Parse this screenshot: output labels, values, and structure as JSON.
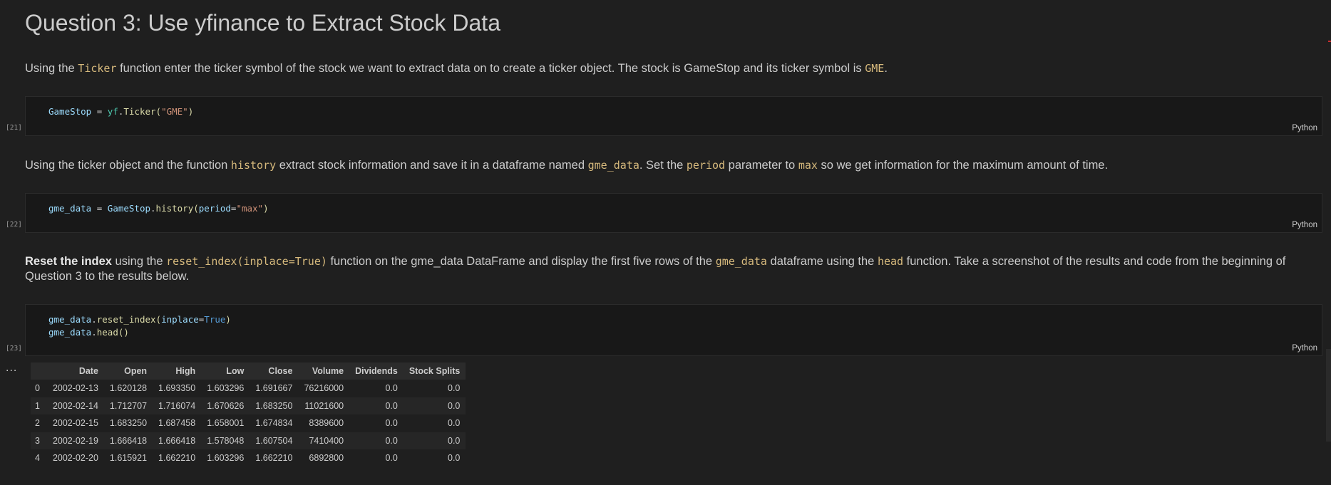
{
  "title": "Question 3: Use yfinance to Extract Stock Data",
  "md1": {
    "a": "Using the ",
    "c1": "Ticker",
    "b": " function enter the ticker symbol of the stock we want to extract data on to create a ticker object. The stock is GameStop and its ticker symbol is ",
    "c2": "GME",
    "d": "."
  },
  "cell1": {
    "exec": "[21]",
    "lang": "Python",
    "t1": "GameStop",
    "t2": " = ",
    "t3": "yf",
    "t4": ".",
    "t5": "Ticker",
    "t6": "(",
    "t7": "\"GME\"",
    "t8": ")"
  },
  "md2": {
    "a": "Using the ticker object and the function ",
    "c1": "history",
    "b": " extract stock information and save it in a dataframe named ",
    "c2": "gme_data",
    "d": ". Set the ",
    "c3": "period",
    "e": " parameter to ",
    "c4": "max",
    "f": " so we get information for the maximum amount of time."
  },
  "cell2": {
    "exec": "[22]",
    "lang": "Python",
    "t1": "gme_data",
    "t2": " = ",
    "t3": "GameStop",
    "t4": ".",
    "t5": "history",
    "t6": "(",
    "t7": "period",
    "t8": "=",
    "t9": "\"max\"",
    "t10": ")"
  },
  "md3": {
    "bold": "Reset the index",
    "a": " using the ",
    "c1": "reset_index(inplace=True)",
    "b": " function on the gme_data DataFrame and display the first five rows of the ",
    "c2": "gme_data",
    "d": " dataframe using the ",
    "c3": "head",
    "e": " function. Take a screenshot of the results and code from the beginning of Question 3 to the results below."
  },
  "cell3": {
    "exec": "[23]",
    "lang": "Python",
    "l1a": "gme_data",
    "l1b": ".",
    "l1c": "reset_index",
    "l1d": "(",
    "l1e": "inplace",
    "l1f": "=",
    "l1g": "True",
    "l1h": ")",
    "l2a": "gme_data",
    "l2b": ".",
    "l2c": "head",
    "l2d": "()"
  },
  "output": {
    "dots": "...",
    "columns": [
      "",
      "Date",
      "Open",
      "High",
      "Low",
      "Close",
      "Volume",
      "Dividends",
      "Stock Splits"
    ],
    "rows": [
      [
        "0",
        "2002-02-13",
        "1.620128",
        "1.693350",
        "1.603296",
        "1.691667",
        "76216000",
        "0.0",
        "0.0"
      ],
      [
        "1",
        "2002-02-14",
        "1.712707",
        "1.716074",
        "1.670626",
        "1.683250",
        "11021600",
        "0.0",
        "0.0"
      ],
      [
        "2",
        "2002-02-15",
        "1.683250",
        "1.687458",
        "1.658001",
        "1.674834",
        "8389600",
        "0.0",
        "0.0"
      ],
      [
        "3",
        "2002-02-19",
        "1.666418",
        "1.666418",
        "1.578048",
        "1.607504",
        "7410400",
        "0.0",
        "0.0"
      ],
      [
        "4",
        "2002-02-20",
        "1.615921",
        "1.662210",
        "1.603296",
        "1.662210",
        "6892800",
        "0.0",
        "0.0"
      ]
    ]
  }
}
